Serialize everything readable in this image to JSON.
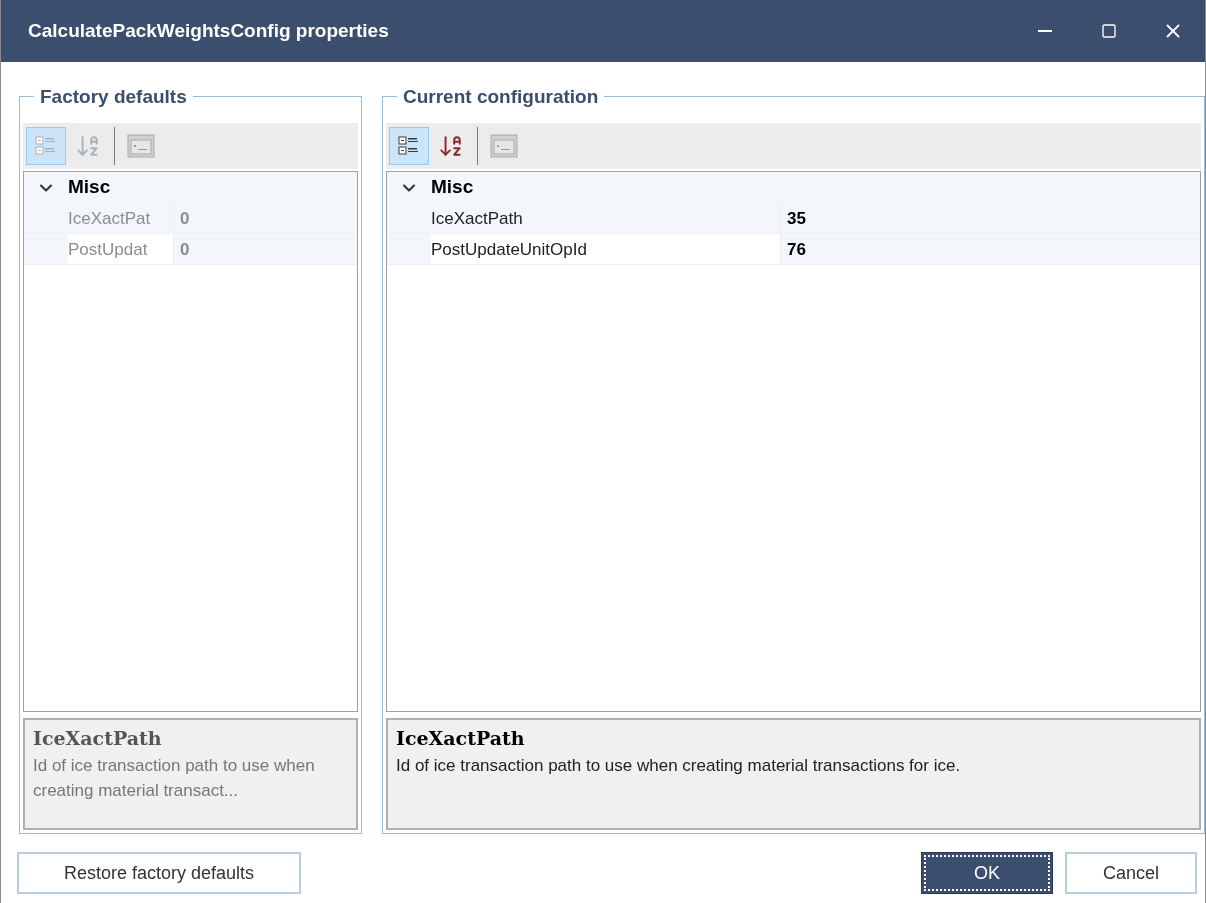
{
  "window": {
    "title": "CalculatePackWeightsConfig properties"
  },
  "panels": [
    {
      "title": "Factory defaults",
      "disabled": true,
      "categorized_selected": true,
      "category": {
        "name": "Misc",
        "expanded": true
      },
      "properties": [
        {
          "name": "IceXactPat",
          "value": "0",
          "selected": true
        },
        {
          "name": "PostUpdat",
          "value": "0",
          "selected": false
        }
      ],
      "description": {
        "title": "IceXactPath",
        "text": "Id of ice transaction path to use when creating material transact..."
      }
    },
    {
      "title": "Current configuration",
      "disabled": false,
      "categorized_selected": true,
      "category": {
        "name": "Misc",
        "expanded": true
      },
      "properties": [
        {
          "name": "IceXactPath",
          "value": "35",
          "selected": true
        },
        {
          "name": "PostUpdateUnitOpId",
          "value": "76",
          "selected": false
        }
      ],
      "description": {
        "title": "IceXactPath",
        "text": "Id of ice transaction path to use when creating material transactions for ice."
      }
    }
  ],
  "buttons": [
    {
      "label": "Restore factory defaults",
      "default": false
    },
    {
      "label": "OK",
      "default": true
    },
    {
      "label": "Cancel",
      "default": false
    }
  ]
}
